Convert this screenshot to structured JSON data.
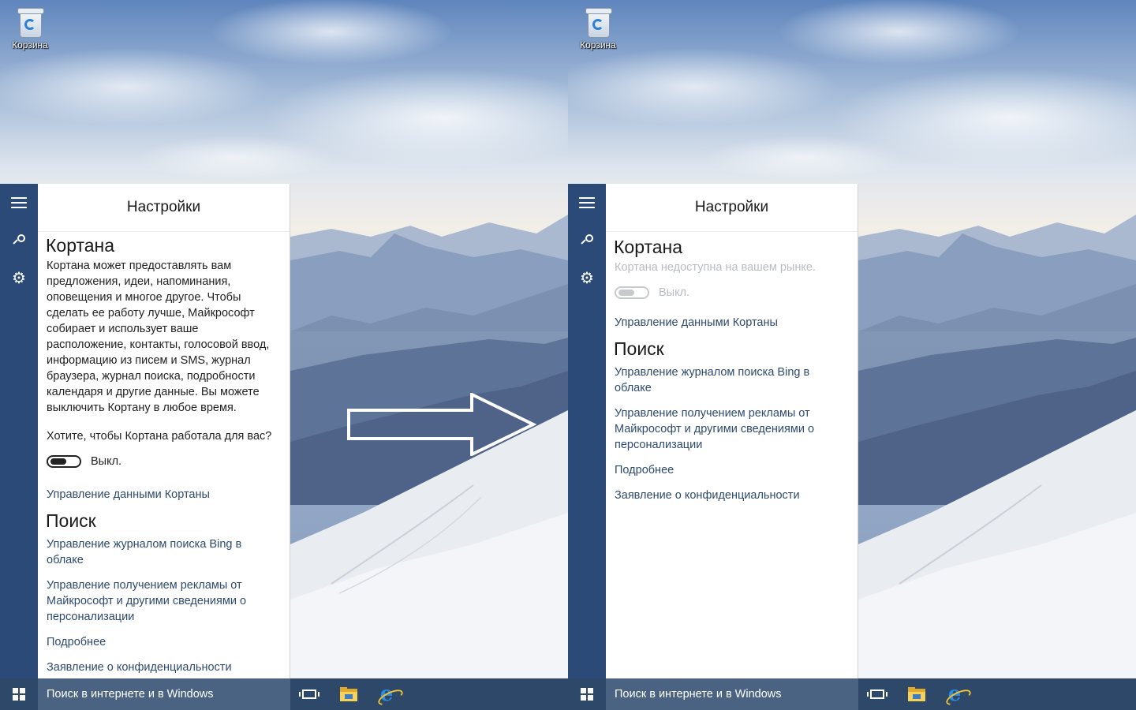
{
  "desktop": {
    "recycle_bin_label": "Корзина"
  },
  "taskbar": {
    "search_placeholder": "Поиск в интернете и в Windows"
  },
  "left_panel": {
    "header_title": "Настройки",
    "cortana": {
      "heading": "Кортана",
      "description": "Кортана может предоставлять вам предложения, идеи, напоминания, оповещения и многое другое. Чтобы сделать ее работу лучше, Майкрософт собирает и использует ваше расположение, контакты, голосовой ввод, информацию из писем и SMS, журнал браузера, журнал поиска, подробности календаря и другие данные. Вы можете выключить Кортану в любое время.",
      "question": "Хотите, чтобы Кортана работала для вас?",
      "toggle_label": "Выкл.",
      "manage_data_link": "Управление данными Кортаны"
    },
    "search": {
      "heading": "Поиск",
      "links": [
        "Управление журналом поиска Bing в облаке",
        "Управление получением рекламы от Майкрософт и другими сведениями о персонализации",
        "Подробнее",
        "Заявление о конфиденциальности"
      ]
    }
  },
  "right_panel": {
    "header_title": "Настройки",
    "cortana": {
      "heading": "Кортана",
      "unavailable_text": "Кортана недоступна на вашем рынке.",
      "toggle_label": "Выкл.",
      "manage_data_link": "Управление данными Кортаны"
    },
    "search": {
      "heading": "Поиск",
      "links": [
        "Управление журналом поиска Bing в облаке",
        "Управление получением рекламы от Майкрософт и другими сведениями о персонализации",
        "Подробнее",
        "Заявление о конфиденциальности"
      ]
    }
  },
  "icons": {
    "menu": "hamburger-icon",
    "search": "search-icon",
    "settings": "gear-icon",
    "start": "windows-logo-icon",
    "task_view": "task-view-icon",
    "explorer": "file-explorer-icon",
    "browser": "internet-explorer-icon",
    "transition": "arrow-right-icon"
  },
  "colors": {
    "rail": "#2b4a78",
    "taskbar": "#2d4869",
    "link": "#2e4a6e",
    "muted": "#b9bcc1"
  }
}
